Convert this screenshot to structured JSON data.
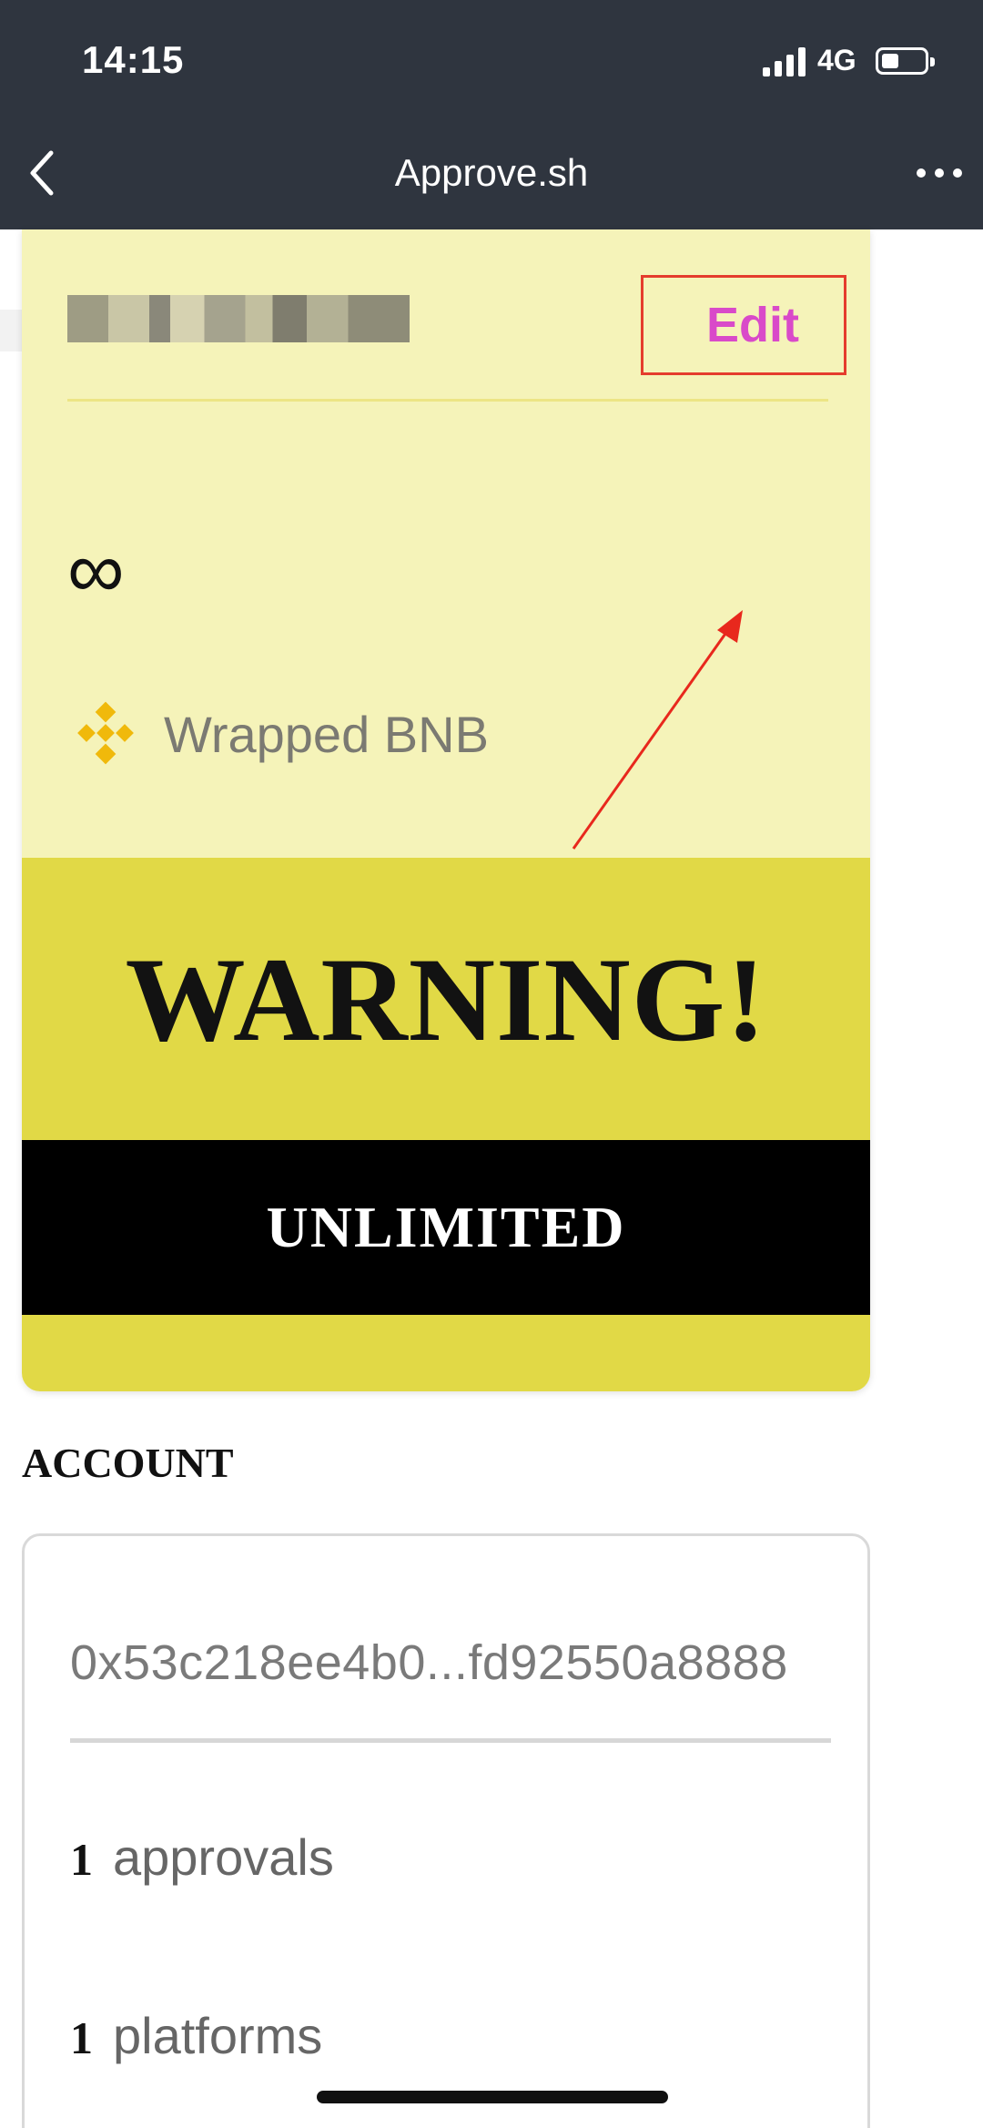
{
  "status_bar": {
    "time": "14:15",
    "network": "4G",
    "icons": [
      "signal-icon",
      "battery-icon"
    ]
  },
  "nav": {
    "title": "Approve.sh",
    "back_icon": "chevron-left-icon",
    "more_icon": "more-horizontal-icon"
  },
  "token_card": {
    "edit_label": "Edit",
    "amount_symbol": "∞",
    "token_icon": "bnb-logo-icon",
    "token_name": "Wrapped BNB",
    "warning": "WARNING!",
    "unlimited": "UNLIMITED",
    "colors": {
      "card_bg": "#f5f3b9",
      "warning_bg": "#e1d946",
      "edit_text": "#d94ac9",
      "highlight_border": "#e53c2d"
    }
  },
  "account": {
    "label": "ACCOUNT",
    "address": "0x53c218ee4b0...fd92550a8888",
    "approvals_count": "1",
    "approvals_label": "approvals",
    "platforms_count": "1",
    "platforms_label": "platforms"
  }
}
